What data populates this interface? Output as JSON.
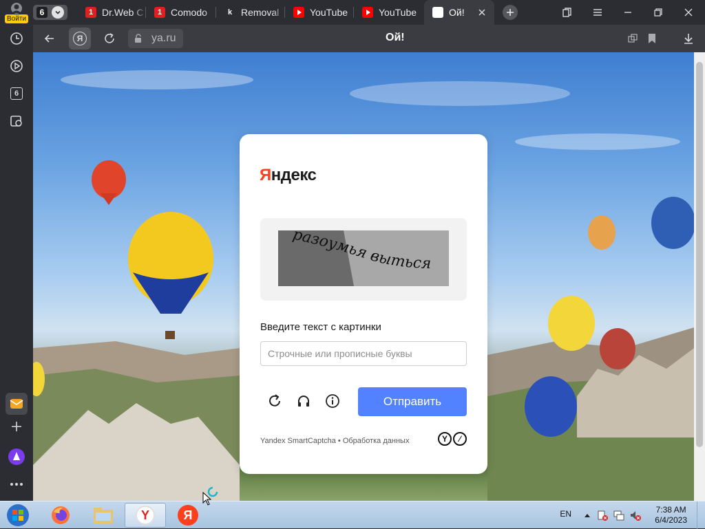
{
  "profile": {
    "login_label": "Войти"
  },
  "tab_counter": "6",
  "tabs": [
    {
      "title": "Dr.Web C",
      "favicon": "drweb-icon"
    },
    {
      "title": "Comodo",
      "favicon": "comodo-icon"
    },
    {
      "title": "Removal",
      "favicon": "k-icon"
    },
    {
      "title": "YouTube",
      "favicon": "youtube-icon"
    },
    {
      "title": "YouTube",
      "favicon": "youtube-icon"
    },
    {
      "title": "Ой!",
      "favicon": "yandex-icon",
      "active": true
    }
  ],
  "addressbar": {
    "url": "ya.ru",
    "page_title": "Ой!"
  },
  "sidebar": {
    "tabs_count": "6"
  },
  "captcha": {
    "logo_first": "Я",
    "logo_rest": "ндекс",
    "captcha_text": "разоумья выться",
    "prompt": "Введите текст с картинки",
    "input_placeholder": "Строчные или прописные буквы",
    "input_value": "",
    "submit_label": "Отправить",
    "footer": "Yandex SmartCaptcha • Обработка данных"
  },
  "taskbar": {
    "language": "EN",
    "time": "7:38 AM",
    "date": "6/4/2023"
  },
  "colors": {
    "submit": "#5282ff",
    "brand_red": "#fc3f1d",
    "chrome": "#2b2d33"
  }
}
